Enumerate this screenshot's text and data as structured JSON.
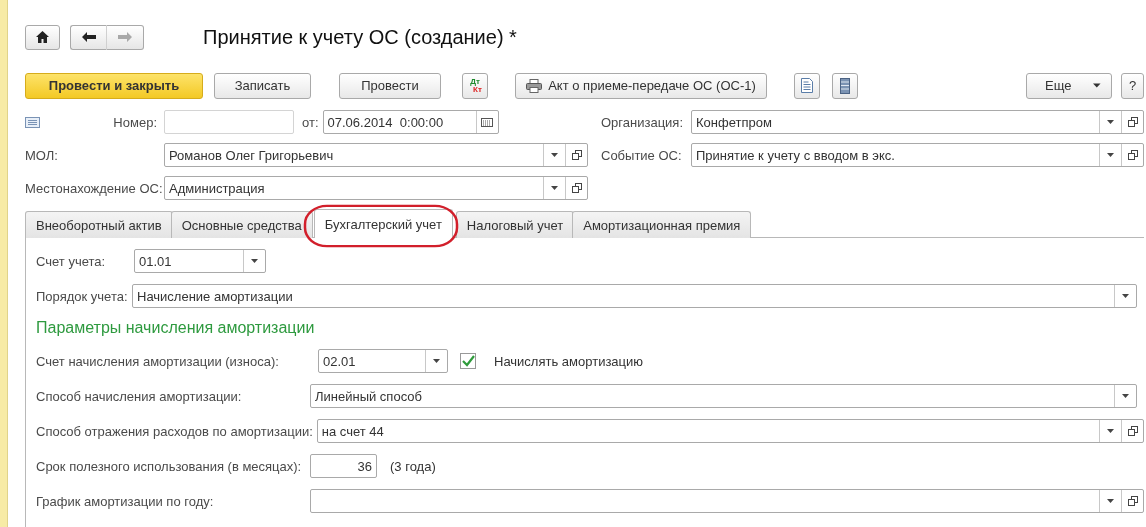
{
  "window": {
    "title": "Принятие к учету ОС (создание) *"
  },
  "nav_buttons": [
    {
      "kind": "home",
      "disabled": false
    },
    {
      "kind": "back",
      "disabled": false
    },
    {
      "kind": "forward",
      "disabled": true
    }
  ],
  "toolbar": [
    {
      "kind": "primary",
      "label": "Провести и закрыть"
    },
    {
      "kind": "button",
      "label": "Записать"
    },
    {
      "kind": "button",
      "label": "Провести"
    },
    {
      "kind": "dtkt",
      "top": "Дт",
      "bottom": "Кт"
    },
    {
      "kind": "print",
      "label": "Акт о приеме-передаче ОС (ОС-1)"
    },
    {
      "kind": "report"
    },
    {
      "kind": "list"
    },
    {
      "kind": "more",
      "label": "Еще"
    },
    {
      "kind": "help",
      "label": "?"
    }
  ],
  "header": {
    "number": {
      "label": "Номер:"
    },
    "date": {
      "label": "от:",
      "value": "07.06.2014  0:00:00"
    },
    "organization": {
      "label": "Организация:",
      "value": "Конфетпром"
    },
    "mol": {
      "label": "МОЛ:",
      "value": "Романов Олег Григорьевич"
    },
    "event": {
      "label": "Событие ОС:",
      "value": "Принятие к учету с вводом в экс."
    },
    "location": {
      "label": "Местонахождение ОС:",
      "value": "Администрация"
    }
  },
  "tabs": [
    {
      "label": "Внеоборотный актив",
      "selected": false,
      "circled": false
    },
    {
      "label": "Основные средства",
      "selected": false,
      "circled": false
    },
    {
      "label": "Бухгалтерский учет",
      "selected": true,
      "circled": true
    },
    {
      "label": "Налоговый учет",
      "selected": false,
      "circled": false
    },
    {
      "label": "Амортизационная премия",
      "selected": false,
      "circled": false
    }
  ],
  "accounting": {
    "account": {
      "label": "Счет учета:",
      "value": "01.01"
    },
    "order": {
      "label": "Порядок учета:",
      "value": "Начисление амортизации"
    },
    "section_title": "Параметры начисления амортизации",
    "rows": [
      {
        "kind": "account",
        "label": "Счет начисления амортизации (износа):",
        "value": "02.01",
        "checkbox": {
          "label": "Начислять амортизацию",
          "checked": true
        }
      },
      {
        "kind": "select",
        "label": "Способ начисления амортизации:",
        "value": "Линейный способ"
      },
      {
        "kind": "reference",
        "label": "Способ отражения расходов по амортизации:",
        "value": "на  счет 44"
      },
      {
        "kind": "number",
        "label": "Срок полезного использования (в месяцах):",
        "value": "36",
        "note": "(3 года)"
      },
      {
        "kind": "reference",
        "label": "График амортизации по году:"
      }
    ]
  }
}
